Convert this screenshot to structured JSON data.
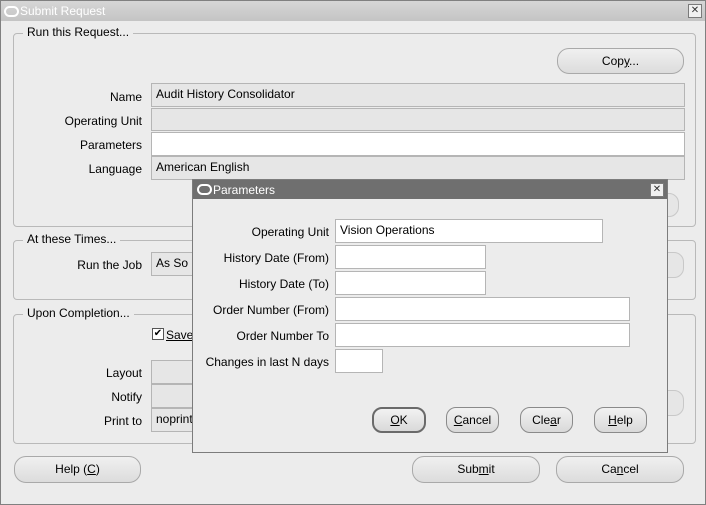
{
  "window": {
    "title": "Submit Request"
  },
  "run_group": {
    "legend": "Run this Request...",
    "copy_button": {
      "pre": "Cop",
      "mn": "y",
      "post": "..."
    },
    "name_label": "Name",
    "name_value": "Audit History Consolidator",
    "operating_unit_label": "Operating Unit",
    "operating_unit_value": "",
    "parameters_label": "Parameters",
    "parameters_value": "",
    "language_label": "Language",
    "language_value": "American English"
  },
  "times_group": {
    "legend": "At these Times...",
    "run_job_label": "Run the Job",
    "run_job_value": "As So"
  },
  "completion_group": {
    "legend": "Upon Completion...",
    "save_label": "Save",
    "save_checked": true,
    "layout_label": "Layout",
    "notify_label": "Notify",
    "print_to_label": "Print to",
    "print_to_value": "noprint"
  },
  "footer": {
    "help_button": {
      "pre": "Help (",
      "mn": "C",
      "post": ")"
    },
    "submit_button": {
      "pre": "Sub",
      "mn": "m",
      "post": "it"
    },
    "cancel_button": {
      "pre": "Ca",
      "mn": "n",
      "post": "cel"
    }
  },
  "dialog": {
    "title": "Parameters",
    "fields": {
      "operating_unit_label": "Operating Unit",
      "operating_unit_value": "Vision Operations",
      "history_from_label": "History Date (From)",
      "history_from_value": "",
      "history_to_label": "History Date (To)",
      "history_to_value": "",
      "order_from_label": "Order Number (From)",
      "order_from_value": "",
      "order_to_label": "Order Number To",
      "order_to_value": "",
      "changes_label": "Changes in last N days",
      "changes_value": ""
    },
    "buttons": {
      "ok": {
        "pre": "",
        "mn": "O",
        "post": "K"
      },
      "cancel": {
        "pre": "",
        "mn": "C",
        "post": "ancel"
      },
      "clear": {
        "pre": "Cle",
        "mn": "a",
        "post": "r"
      },
      "help": {
        "pre": "",
        "mn": "H",
        "post": "elp"
      }
    }
  }
}
